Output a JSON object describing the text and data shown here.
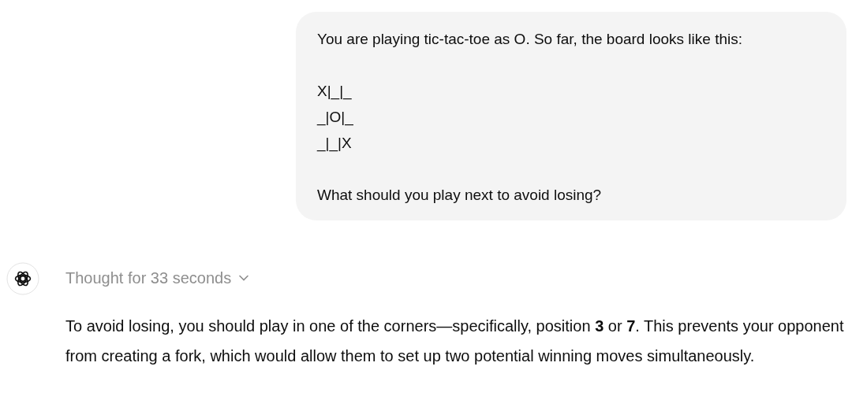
{
  "user_message": {
    "blocks": [
      {
        "kind": "text",
        "text": "You are playing tic-tac-toe as O. So far, the board looks like this:"
      },
      {
        "kind": "board",
        "rows": [
          "X|_|_",
          "_|O|_",
          "_|_|X"
        ]
      },
      {
        "kind": "text",
        "text": "What should you play next to avoid losing?"
      }
    ]
  },
  "assistant": {
    "thought": {
      "label": "Thought for 33 seconds",
      "expanded": false
    },
    "answer": "To avoid losing, you should play in one of the corners—specifically, position **3** or **7**. This prevents your opponent from creating a fork, which would allow them to set up two potential winning moves simultaneously."
  }
}
